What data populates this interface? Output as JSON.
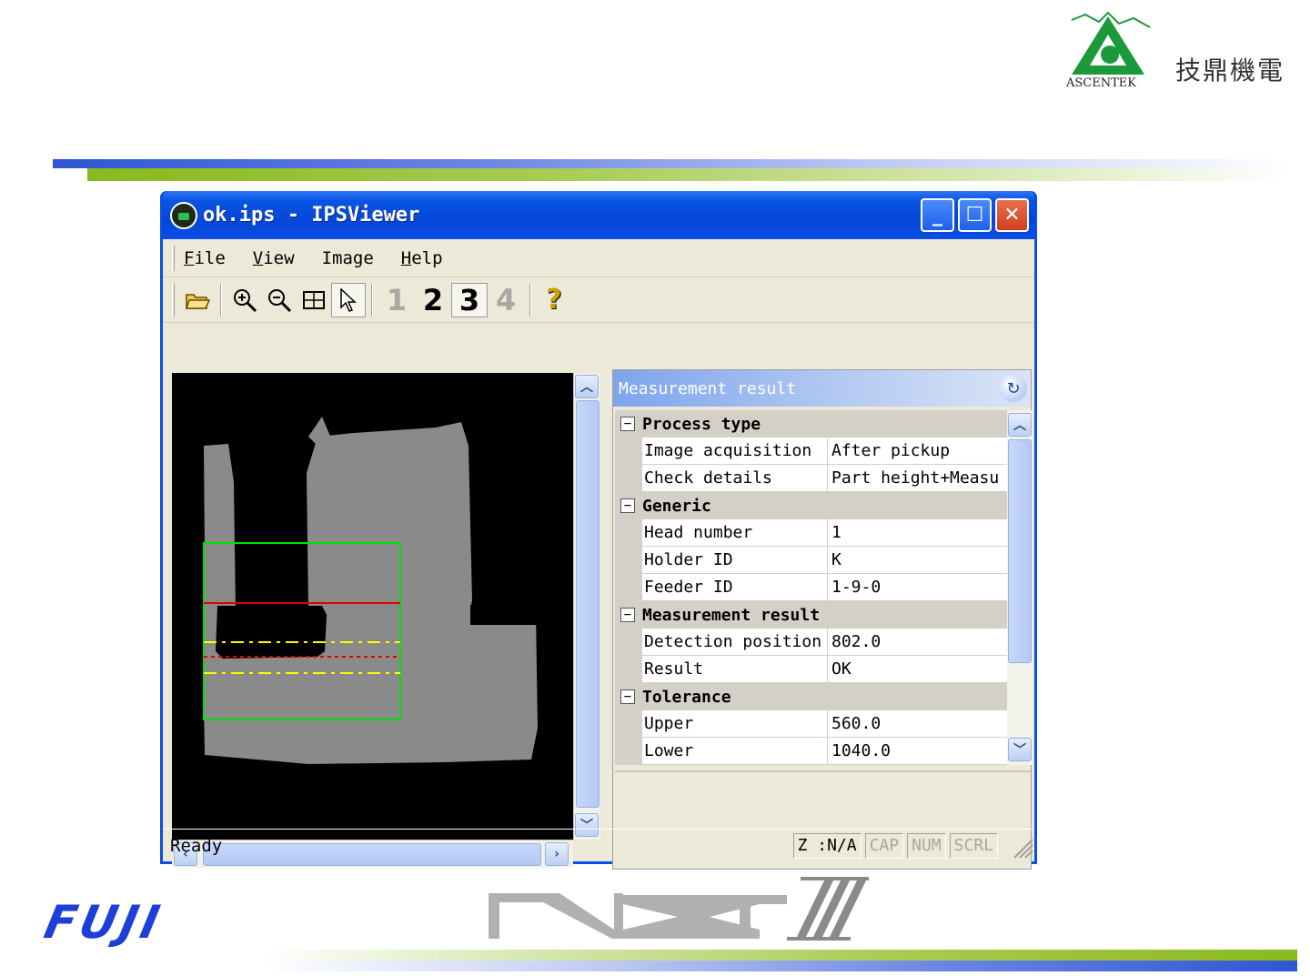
{
  "branding": {
    "logo_text": "ASCENTEK",
    "logo_cn": "技鼎機電",
    "footer_left": "FUJI",
    "footer_right": "NXT III"
  },
  "window": {
    "title": "ok.ips - IPSViewer",
    "controls": [
      "minimize",
      "maximize",
      "close"
    ]
  },
  "menu": [
    {
      "key": "F",
      "rest": "ile"
    },
    {
      "key": "V",
      "rest": "iew"
    },
    {
      "key": "",
      "rest": "Image"
    },
    {
      "key": "H",
      "rest": "elp"
    }
  ],
  "toolbar": {
    "tools": [
      "open-folder-icon",
      "zoom-in-icon",
      "zoom-out-icon",
      "fit-icon",
      "pointer-icon"
    ],
    "numbers": [
      "1",
      "2",
      "3",
      "4"
    ],
    "selected_number": "3",
    "help": "?"
  },
  "measurement": {
    "title": "Measurement result",
    "groups": [
      {
        "name": "Process type",
        "items": [
          {
            "k": "Image acquisition",
            "v": "After pickup"
          },
          {
            "k": "Check details",
            "v": "Part height+Measu"
          }
        ]
      },
      {
        "name": "Generic",
        "items": [
          {
            "k": "Head number",
            "v": "1"
          },
          {
            "k": "Holder ID",
            "v": "K"
          },
          {
            "k": "Feeder ID",
            "v": "1-9-0"
          }
        ]
      },
      {
        "name": "Measurement result",
        "items": [
          {
            "k": "Detection position",
            "v": "802.0"
          },
          {
            "k": "Result",
            "v": "OK"
          }
        ]
      },
      {
        "name": "Tolerance",
        "items": [
          {
            "k": "Upper",
            "v": "560.0"
          },
          {
            "k": "Lower",
            "v": "1040.0"
          }
        ]
      }
    ]
  },
  "status": {
    "text": "Ready",
    "panels": [
      {
        "label": "Z :N/A",
        "enabled": true
      },
      {
        "label": "CAP",
        "enabled": false
      },
      {
        "label": "NUM",
        "enabled": false
      },
      {
        "label": "SCRL",
        "enabled": false
      }
    ]
  },
  "colors": {
    "title_blue": "#0a55e4",
    "box_green": "#00e000",
    "line_red": "#e00000",
    "line_yellow": "#ffff00",
    "fuji_blue": "#1e3ed8"
  }
}
